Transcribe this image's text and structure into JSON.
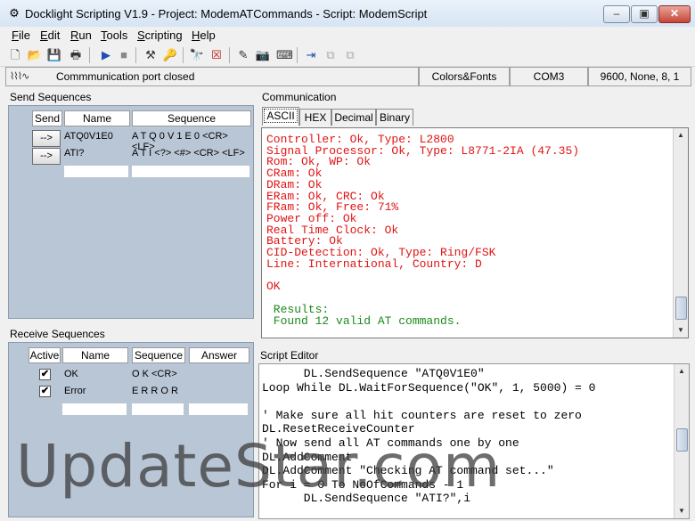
{
  "window": {
    "title": "Docklight Scripting V1.9 - Project: ModemATCommands - Script: ModemScript"
  },
  "menu": [
    {
      "label": "File",
      "u": "F",
      "rest": "ile"
    },
    {
      "label": "Edit",
      "u": "E",
      "rest": "dit"
    },
    {
      "label": "Run",
      "u": "R",
      "rest": "un"
    },
    {
      "label": "Tools",
      "u": "T",
      "rest": "ools"
    },
    {
      "label": "Scripting",
      "u": "S",
      "rest": "cripting"
    },
    {
      "label": "Help",
      "u": "H",
      "rest": "elp"
    }
  ],
  "status": {
    "message": "Commmunication port closed",
    "mode": "Colors&Fonts Mode",
    "port": "COM3",
    "settings": "9600, None, 8, 1"
  },
  "send": {
    "title": "Send Sequences",
    "headers": [
      "Send",
      "Name",
      "Sequence"
    ],
    "button_label": "-->",
    "rows": [
      {
        "name": "ATQ0V1E0",
        "sequence": "A T Q 0 V 1 E 0 <CR> <LF>"
      },
      {
        "name": "ATI?",
        "sequence": "A T I <?> <#> <CR> <LF>"
      }
    ]
  },
  "receive": {
    "title": "Receive Sequences",
    "headers": [
      "Active",
      "Name",
      "Sequence",
      "Answer"
    ],
    "check_mark": "✔",
    "rows": [
      {
        "name": "OK",
        "sequence": "O K <CR>"
      },
      {
        "name": "Error",
        "sequence": "E R R O R"
      }
    ]
  },
  "communication": {
    "title": "Communication",
    "tabs": [
      "ASCII",
      "HEX",
      "Decimal",
      "Binary"
    ],
    "active_tab": "ASCII",
    "red_lines": [
      "Controller: Ok, Type: L2800",
      "Signal Processor: Ok, Type: L8771-2IA (47.35)",
      "Rom: Ok, WP: Ok",
      "CRam: Ok",
      "DRam: Ok",
      "ERam: Ok, CRC: Ok",
      "FRam: Ok, Free: 71%",
      "Power off: Ok",
      "Real Time Clock: Ok",
      "Battery: Ok",
      "CID-Detection: Ok, Type: Ring/FSK",
      "Line: International, Country: D",
      "",
      "OK",
      ""
    ],
    "green_lines": [
      " Results:",
      " Found 12 valid AT commands."
    ]
  },
  "script_editor": {
    "title": "Script Editor",
    "lines": [
      "      DL.SendSequence \"ATQ0V1E0\"",
      "Loop While DL.WaitForSequence(\"OK\", 1, 5000) = 0",
      "",
      "' Make sure all hit counters are reset to zero",
      "DL.ResetReceiveCounter",
      "' Now send all AT commands one by one",
      "DL.AddComment",
      "DL.AddComment \"Checking AT command set...\"",
      "For i = 0 To NoOfCommands - 1",
      "      DL.SendSequence \"ATI?\",i"
    ]
  },
  "watermark": "UpdateStar.com",
  "colors": {
    "comm_text": "#e01414",
    "result_text": "#1a8a1a",
    "grid_bg": "#b9c6d6"
  }
}
